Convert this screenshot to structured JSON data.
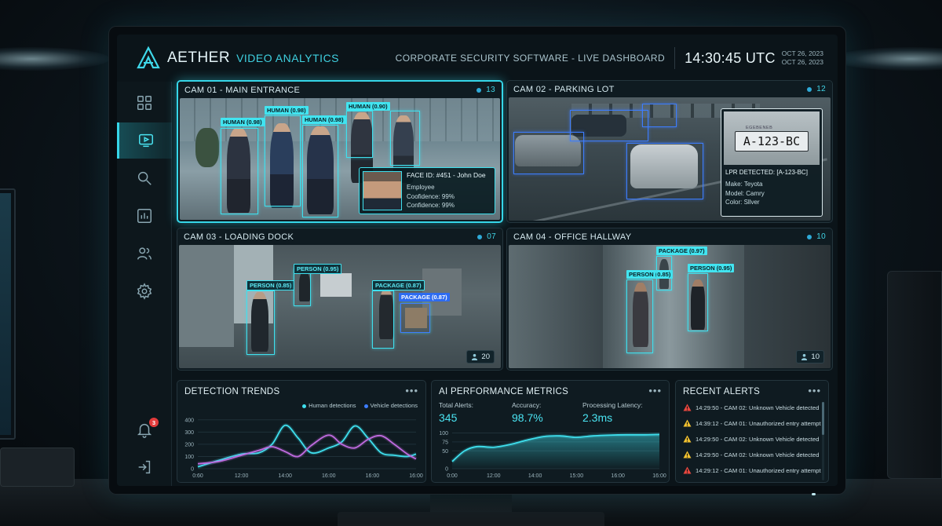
{
  "header": {
    "brand": "AETHER",
    "brand_sub": "VIDEO ANALYTICS",
    "title": "CORPORATE SECURITY SOFTWARE - LIVE DASHBOARD",
    "clock": "14:30:45 UTC",
    "date1": "OCT 26, 2023",
    "date2": "OCT 26, 2023"
  },
  "sidebar": {
    "items": [
      {
        "icon": "grid-icon"
      },
      {
        "icon": "video-icon",
        "active": true
      },
      {
        "icon": "search-icon"
      },
      {
        "icon": "analytics-icon"
      },
      {
        "icon": "users-icon"
      },
      {
        "icon": "gear-icon"
      }
    ],
    "notification_count": "3",
    "bottom": [
      {
        "icon": "bell-icon"
      },
      {
        "icon": "logout-icon"
      }
    ]
  },
  "cameras": {
    "cam1": {
      "title": "CAM 01 - MAIN ENTRANCE",
      "count": "13",
      "labels": [
        "HUMAN (0.98)",
        "HUMAN (0.98)",
        "HUMAN (0.98)",
        "HUMAN (0.90)"
      ],
      "face": {
        "id": "FACE ID: #451 - John Doe",
        "line1": "Employee",
        "line2": "Coofidence: 99%",
        "line3": "Confidence: 99%"
      }
    },
    "cam2": {
      "title": "CAM 02 - PARKING LOT",
      "count": "12",
      "plate": "A-123-BC",
      "plate_top": "EGEBENEB",
      "lpr": {
        "title": "LPR DETECTED: [A-123-BC]",
        "make": "Make: Teyota",
        "model": "Model: Camry",
        "color": "Color: Sllver"
      }
    },
    "cam3": {
      "title": "CAM 03 - LOADING DOCK",
      "count": "07",
      "labels": [
        "PERSON (0.95)",
        "PERSON (0.85)",
        "PACKAGE (0.87)",
        "PACKAGE (0.87)"
      ],
      "people": "20"
    },
    "cam4": {
      "title": "CAM 04 - OFFICE HALLWAY",
      "count": "10",
      "labels": [
        "PACKAGE (0.97)",
        "PERSON (0.85)",
        "PERSON (0.95)"
      ],
      "people": "10"
    }
  },
  "detection_trends": {
    "title": "DETECTION TRENDS",
    "more": "•••",
    "legend_human": "Human detections",
    "legend_vehicle": "Vehicle detections",
    "colors": {
      "human": "#3fe0ee",
      "vehicle": "#c06be0"
    }
  },
  "ai_metrics": {
    "title": "AI PERFORMANCE METRICS",
    "more": "•••",
    "metrics": [
      {
        "label": "Total Alerts:",
        "value": "345"
      },
      {
        "label": "Accuracy:",
        "value": "98.7%"
      },
      {
        "label": "Processing Latency:",
        "value": "2.3ms"
      }
    ]
  },
  "recent_alerts": {
    "title": "RECENT ALERTS",
    "more": "•••",
    "items": [
      {
        "level": "critical",
        "text": "14:29:50 - CAM 02: Unknown Vehicle detected"
      },
      {
        "level": "warning",
        "text": "14:39:12 - CAM 01: Unauthorized entry attempt"
      },
      {
        "level": "warning",
        "text": "14:29:50 - CAM 02: Unknown Vehicle detected"
      },
      {
        "level": "warning",
        "text": "14:29:50 - CAM 02: Unknown Vehicle detected"
      },
      {
        "level": "critical",
        "text": "14:29:12 - CAM 01: Unauthorized entry attempt"
      }
    ],
    "colors": {
      "critical": "#e8473f",
      "warning": "#f2c230"
    }
  },
  "chart_data": [
    {
      "type": "line",
      "title": "DETECTION TRENDS",
      "x": [
        "0:60",
        "12:00",
        "14:00",
        "16:00",
        "16:00",
        "16:00"
      ],
      "yticks": [
        0,
        100,
        200,
        300,
        400
      ],
      "ylim": [
        0,
        450
      ],
      "grid": true,
      "legend": "top-right",
      "series": [
        {
          "name": "Human detections",
          "x": [
            0,
            0.5,
            1,
            1.4,
            1.7,
            2,
            2.3,
            2.6,
            3,
            3.3,
            3.6,
            3.9,
            4.2,
            4.5,
            4.8,
            5
          ],
          "values": [
            15,
            70,
            120,
            130,
            200,
            355,
            250,
            130,
            170,
            220,
            350,
            250,
            130,
            110,
            100,
            120
          ]
        },
        {
          "name": "Vehicle detections",
          "x": [
            0,
            0.5,
            1,
            1.4,
            1.7,
            2,
            2.3,
            2.6,
            3,
            3.3,
            3.6,
            3.9,
            4.2,
            4.5,
            4.8,
            5
          ],
          "values": [
            40,
            60,
            110,
            150,
            180,
            140,
            100,
            190,
            275,
            200,
            170,
            240,
            270,
            200,
            120,
            80
          ]
        }
      ]
    },
    {
      "type": "area",
      "title": "AI PERFORMANCE METRICS",
      "x": [
        "0:00",
        "12:00",
        "14:00",
        "15:00",
        "16:00",
        "16:00"
      ],
      "yticks": [
        0,
        50,
        75,
        100
      ],
      "ylim": [
        0,
        110
      ],
      "grid": true,
      "series": [
        {
          "name": "",
          "x": [
            0,
            0.3,
            0.6,
            1,
            1.4,
            1.8,
            2.2,
            2.6,
            3,
            3.4,
            3.8,
            4.2,
            4.6,
            5
          ],
          "values": [
            20,
            50,
            62,
            60,
            68,
            80,
            90,
            92,
            88,
            92,
            94,
            95,
            95,
            96
          ]
        }
      ]
    }
  ]
}
